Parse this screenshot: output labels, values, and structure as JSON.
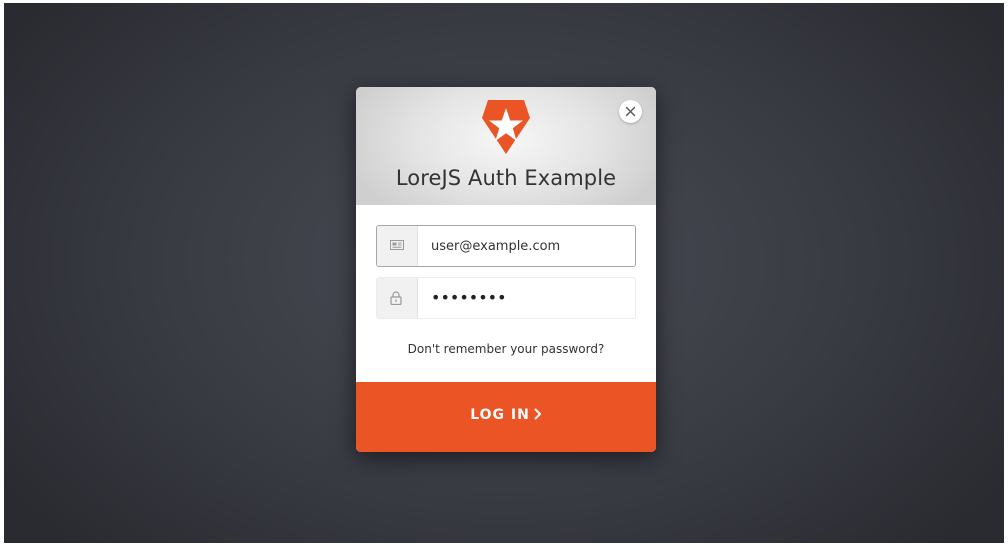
{
  "dialog": {
    "title": "LoreJS Auth Example",
    "logo_icon": "auth0-shield-star-icon",
    "close_icon": "close-icon"
  },
  "form": {
    "email": {
      "icon": "envelope-icon",
      "value": "user@example.com"
    },
    "password": {
      "icon": "lock-icon",
      "value": "••••••••"
    },
    "forgot_link": "Don't remember your password?",
    "submit_label": "LOG IN",
    "submit_icon": "chevron-right-icon"
  },
  "colors": {
    "accent": "#eb5424",
    "backdrop": "#3a3c44",
    "header": "#e4e4e4"
  }
}
